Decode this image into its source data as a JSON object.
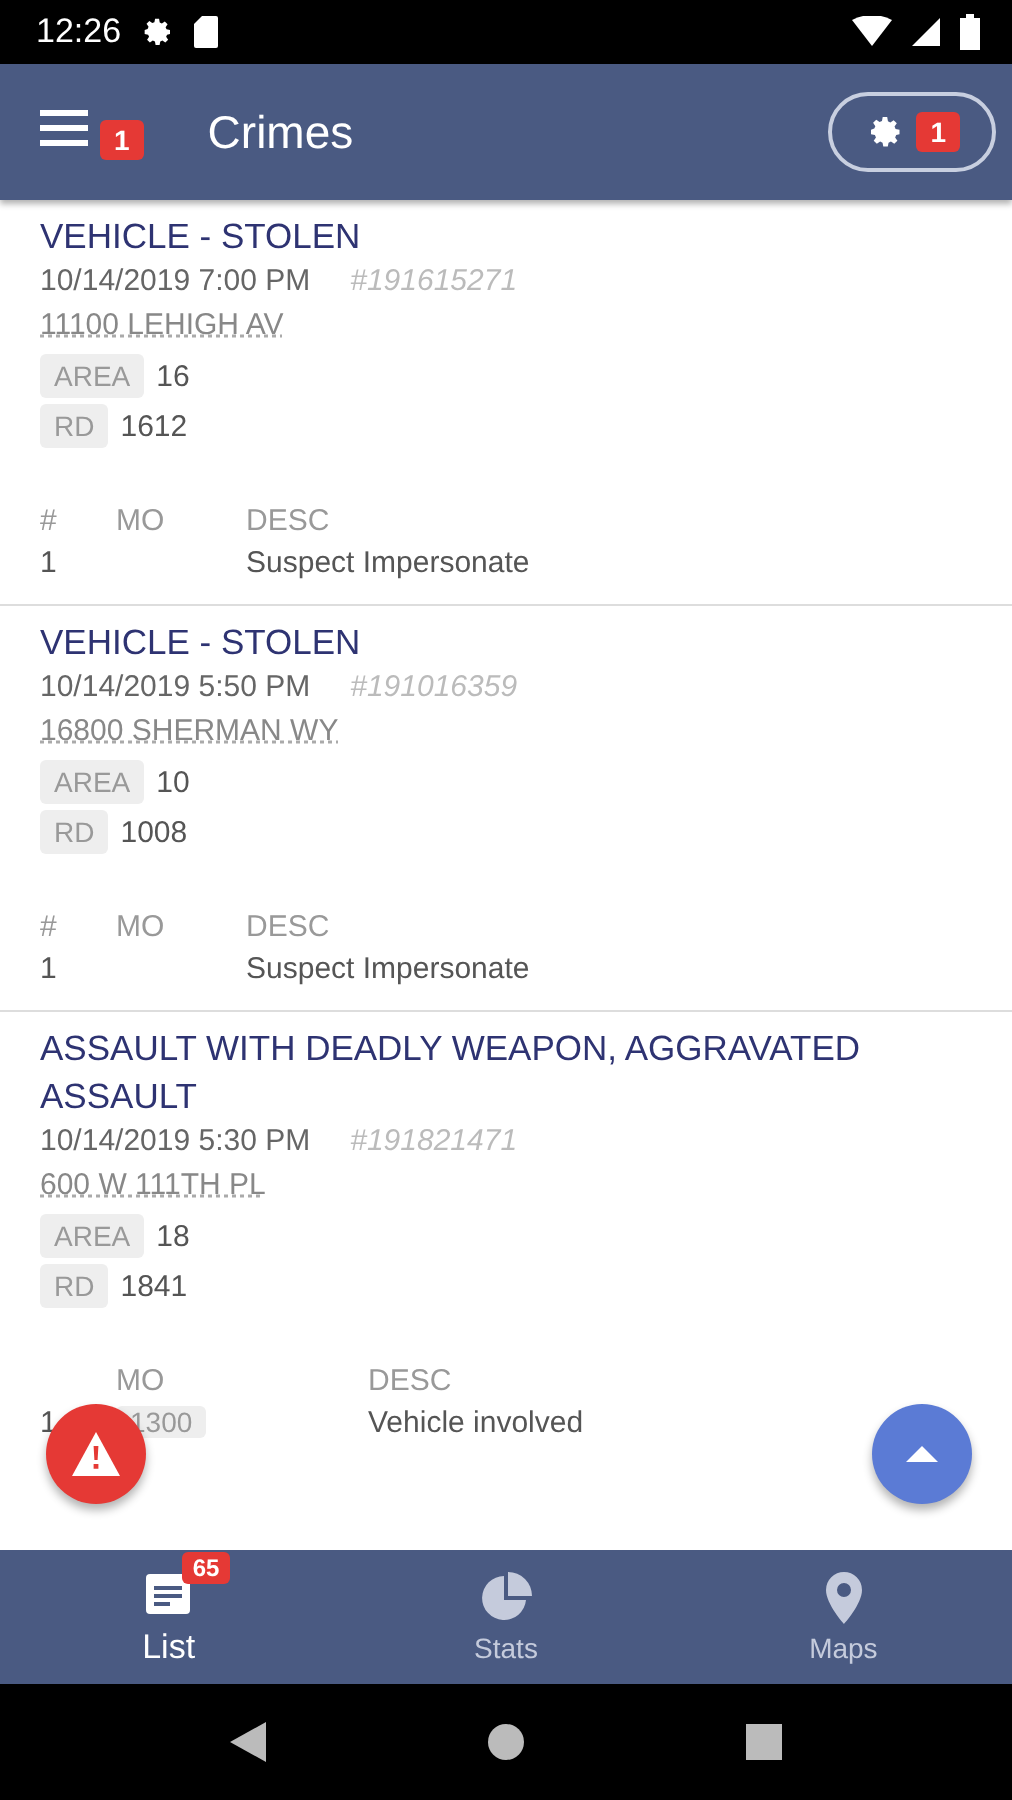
{
  "status_bar": {
    "time": "12:26"
  },
  "app_bar": {
    "title": "Crimes",
    "menu_badge": "1",
    "filter_badge": "1"
  },
  "crimes": [
    {
      "title": "VEHICLE - STOLEN",
      "datetime": "10/14/2019 7:00 PM",
      "number": "#191615271",
      "address": "11100 LEHIGH AV",
      "area_label": "AREA",
      "area": "16",
      "rd_label": "RD",
      "rd": "1612",
      "columns": [
        {
          "kind": "num",
          "label": "#"
        },
        {
          "kind": "mo",
          "label": "MO"
        },
        {
          "kind": "desc",
          "label": "DESC"
        }
      ],
      "rows": [
        {
          "num": "1",
          "desc": "Suspect Impersonate"
        }
      ]
    },
    {
      "title": "VEHICLE - STOLEN",
      "datetime": "10/14/2019 5:50 PM",
      "number": "#191016359",
      "address": "16800 SHERMAN WY",
      "area_label": "AREA",
      "area": "10",
      "rd_label": "RD",
      "rd": "1008",
      "columns": [
        {
          "kind": "num",
          "label": "#"
        },
        {
          "kind": "mo",
          "label": "MO"
        },
        {
          "kind": "desc",
          "label": "DESC"
        }
      ],
      "rows": [
        {
          "num": "1",
          "desc": "Suspect Impersonate"
        }
      ]
    },
    {
      "title": "ASSAULT WITH DEADLY WEAPON, AGGRAVATED ASSAULT",
      "datetime": "10/14/2019 5:30 PM",
      "number": "#191821471",
      "address": "600 W 111TH PL",
      "area_label": "AREA",
      "area": "18",
      "rd_label": "RD",
      "rd": "1841",
      "columns": [
        {
          "kind": "num"
        },
        {
          "kind": "mo",
          "label": "MO"
        },
        {
          "kind": "desc",
          "label": "DESC"
        }
      ],
      "rows": [
        {
          "num": "1",
          "mo": "1300",
          "desc": "Vehicle involved"
        }
      ]
    }
  ],
  "bottom_nav": [
    {
      "kind": "list",
      "label": "List",
      "badge": "65",
      "selected": true
    },
    {
      "kind": "stats",
      "label": "Stats",
      "selected": false
    },
    {
      "kind": "maps",
      "label": "Maps",
      "selected": false
    }
  ]
}
